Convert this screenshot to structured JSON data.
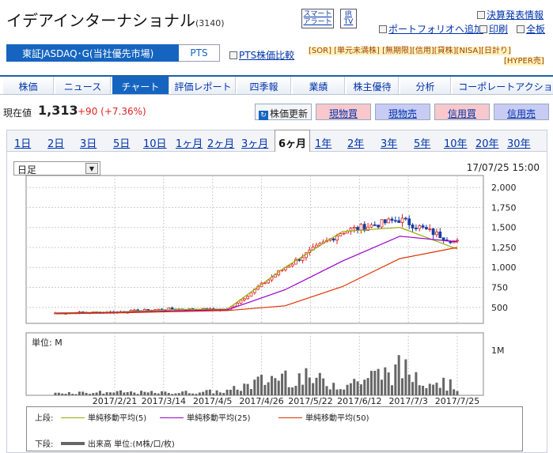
{
  "header": {
    "company": "イデアインターナショナル",
    "code": "(3140)",
    "smart_alert": "スマート\nアラート",
    "irtv": "IR\nTV",
    "links": [
      {
        "label": "決算発表情報",
        "icon": "calendar-icon"
      },
      {
        "label": "ポートフォリオへ追加",
        "icon": "portfolio-icon"
      },
      {
        "label": "印刷",
        "icon": "print-icon"
      },
      {
        "label": "全板",
        "icon": "board-icon"
      }
    ]
  },
  "market": {
    "primary": "東証JASDAQ･G(当社優先市場)",
    "pts": "PTS",
    "pts_compare": "PTS株価比較",
    "tags_line1": "[SOR] [単元未満株] [無期限][信用][貸株][NISA][日計り]",
    "tags_line2": "[HYPER売]"
  },
  "nav": [
    "株価",
    "ニュース",
    "チャート",
    "評価レポート",
    "四季報",
    "業績",
    "株主優待",
    "分析",
    "コーポレートアクション"
  ],
  "nav_active": 2,
  "price": {
    "label": "現在値",
    "value": "1,313",
    "change": "+90 (+7.36%)",
    "refresh": "株価更新",
    "actions": [
      "現物買",
      "現物売",
      "信用買",
      "信用売"
    ]
  },
  "periods": [
    "1日",
    "2日",
    "3日",
    "5日",
    "10日",
    "1ヶ月",
    "2ヶ月",
    "3ヶ月",
    "6ヶ月",
    "1年",
    "2年",
    "3年",
    "5年",
    "10年",
    "20年",
    "30年"
  ],
  "period_active": 8,
  "chart": {
    "select": "日足",
    "timestamp": "17/07/25 15:00",
    "unit_label": "単位: M",
    "legend": {
      "upper_label": "上段:",
      "lower_label": "下段:",
      "ma5": "単純移動平均(5)",
      "ma25": "単純移動平均(25)",
      "ma50": "単純移動平均(50)",
      "volume": "出来高 単位:(M株/口/枚)"
    },
    "colors": {
      "ma5": "#99aa00",
      "ma25": "#9900cc",
      "ma50": "#dd3300",
      "up": "#dd2222",
      "down": "#1a3fa0",
      "volume": "#666666"
    }
  },
  "chart_data": {
    "type": "line",
    "x": [
      "2017/2/21",
      "2017/3/14",
      "2017/4/5",
      "2017/4/26",
      "2017/5/22",
      "2017/6/12",
      "2017/7/3",
      "2017/7/25"
    ],
    "ylim": [
      300,
      2150
    ],
    "y_ticks": [
      "2,000",
      "1,750",
      "1,500",
      "1,250",
      "1,000",
      "750",
      "500"
    ],
    "volume_tick": "1M",
    "series": [
      {
        "name": "単純移動平均(5)",
        "values": [
          430,
          440,
          470,
          480,
          1000,
          1450,
          1500,
          1230
        ]
      },
      {
        "name": "単純移動平均(25)",
        "values": [
          425,
          435,
          455,
          470,
          720,
          1080,
          1390,
          1320
        ]
      },
      {
        "name": "単純移動平均(50)",
        "values": [
          420,
          430,
          445,
          460,
          520,
          760,
          1110,
          1250
        ]
      },
      {
        "name": "出来高 単位:(M株/口/枚)",
        "values": [
          0.05,
          0.06,
          0.05,
          0.08,
          0.4,
          0.2,
          0.5,
          0.15
        ]
      }
    ],
    "approx_close": [
      430,
      440,
      480,
      470,
      1000,
      1450,
      1600,
      1313
    ]
  }
}
